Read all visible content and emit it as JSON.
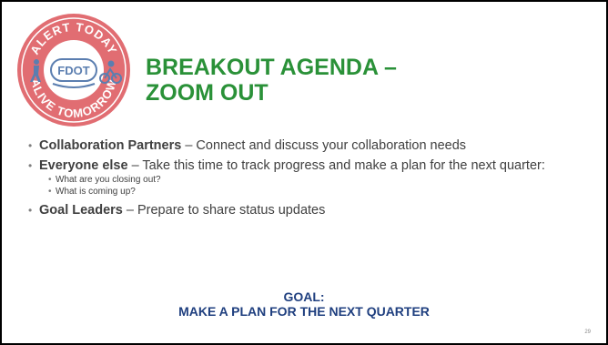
{
  "logo": {
    "top_arc_text": "ALERT TODAY",
    "bottom_arc_text": "ALIVE TOMORROW",
    "center_text": "FDOT",
    "colors": {
      "red": "#d9454b",
      "blue": "#2e5b9a"
    }
  },
  "title": {
    "line1": "BREAKOUT AGENDA –",
    "line2": "ZOOM OUT",
    "color": "#2a9138"
  },
  "bullets": [
    {
      "bold": "Collaboration Partners",
      "text": " – Connect and discuss your collaboration needs"
    },
    {
      "bold": "Everyone else",
      "text": " – Take this time to track progress and make a plan for the next quarter:",
      "sub": [
        "What are you closing out?",
        "What is coming up?"
      ]
    },
    {
      "bold": "Goal Leaders",
      "text": " – Prepare to share status updates"
    }
  ],
  "goal": {
    "label": "GOAL:",
    "text": "MAKE A PLAN FOR THE NEXT QUARTER",
    "color": "#1f3f7f"
  },
  "page_number": "29"
}
